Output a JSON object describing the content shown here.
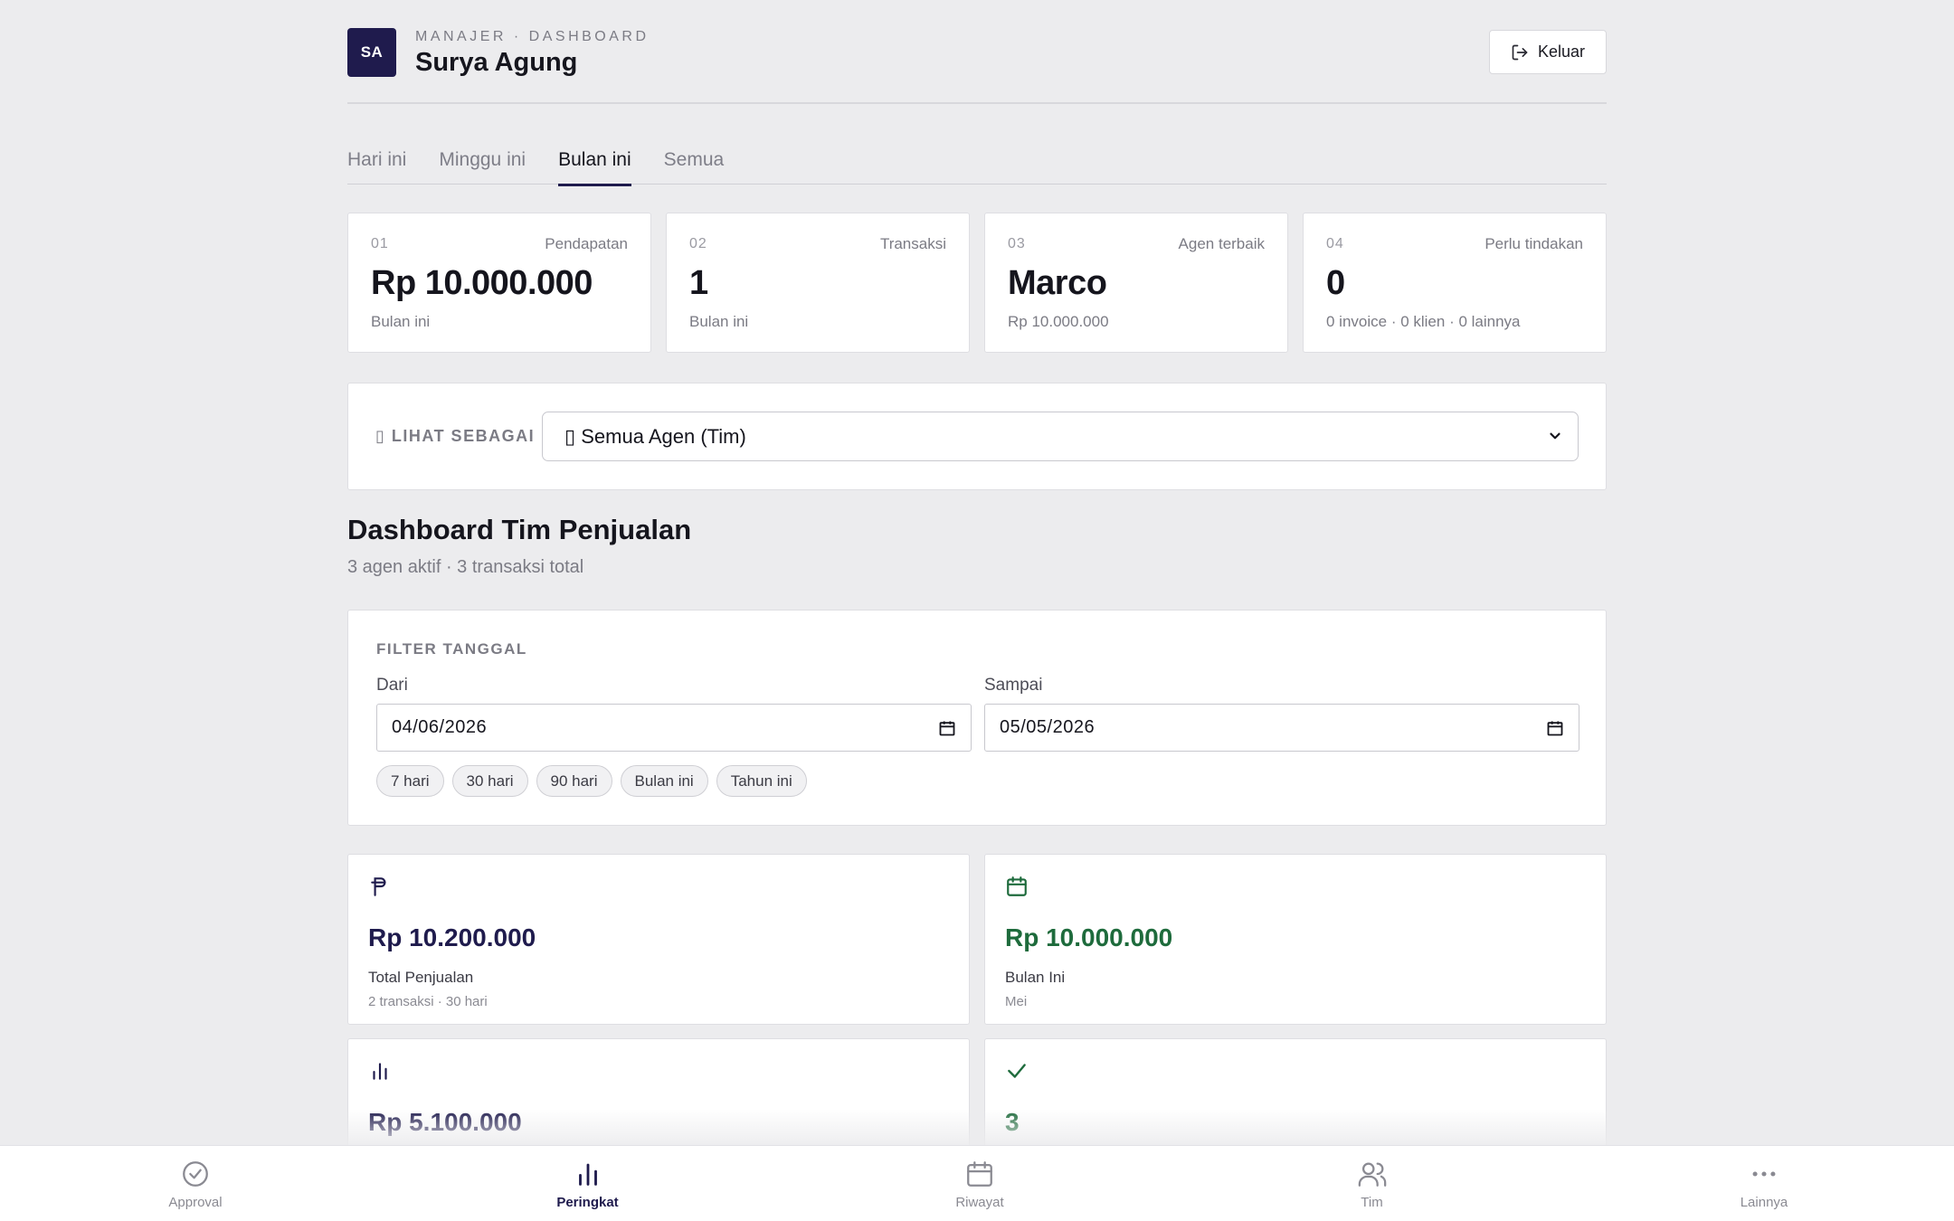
{
  "header": {
    "avatar_initials": "SA",
    "meta": "MANAJER · DASHBOARD",
    "name": "Surya Agung",
    "logout_label": "Keluar"
  },
  "tabs": [
    {
      "label": "Hari ini",
      "active": false
    },
    {
      "label": "Minggu ini",
      "active": false
    },
    {
      "label": "Bulan ini",
      "active": true
    },
    {
      "label": "Semua",
      "active": false
    }
  ],
  "stats": [
    {
      "num": "01",
      "label": "Pendapatan",
      "value": "Rp 10.000.000",
      "sub": "Bulan ini"
    },
    {
      "num": "02",
      "label": "Transaksi",
      "value": "1",
      "sub": "Bulan ini"
    },
    {
      "num": "03",
      "label": "Agen terbaik",
      "value": "Marco",
      "sub": "Rp 10.000.000"
    },
    {
      "num": "04",
      "label": "Perlu tindakan",
      "value": "0",
      "sub": "0 invoice · 0 klien · 0 lainnya"
    }
  ],
  "view_as": {
    "label": "▯ LIHAT SEBAGAI",
    "selected": "▯ Semua Agen (Tim)"
  },
  "section": {
    "title": "Dashboard Tim Penjualan",
    "subtitle": "3 agen aktif · 3 transaksi total"
  },
  "filter": {
    "title": "FILTER TANGGAL",
    "from_label": "Dari",
    "from_value": "04/06/2026",
    "to_label": "Sampai",
    "to_value": "05/05/2026",
    "chips": [
      "7 hari",
      "30 hari",
      "90 hari",
      "Bulan ini",
      "Tahun ini"
    ]
  },
  "metrics": [
    {
      "icon": "rupiah-icon",
      "value": "Rp 10.200.000",
      "label": "Total Penjualan",
      "sub": "2 transaksi · 30 hari",
      "color": "#1f1b4d"
    },
    {
      "icon": "calendar-icon",
      "value": "Rp 10.000.000",
      "label": "Bulan Ini",
      "sub": "Mei",
      "color": "#1e6b3c"
    },
    {
      "icon": "bar-chart-icon",
      "value": "Rp 5.100.000",
      "label": "",
      "sub": "",
      "color": "#1f1b4d"
    },
    {
      "icon": "check-icon",
      "value": "3",
      "label": "",
      "sub": "",
      "color": "#1e6b3c"
    }
  ],
  "bottom_nav": [
    {
      "label": "Approval",
      "icon": "check-circle-icon",
      "active": false
    },
    {
      "label": "Peringkat",
      "icon": "bar-chart-icon",
      "active": true
    },
    {
      "label": "Riwayat",
      "icon": "calendar-icon",
      "active": false
    },
    {
      "label": "Tim",
      "icon": "users-icon",
      "active": false
    },
    {
      "label": "Lainnya",
      "icon": "more-icon",
      "active": false
    }
  ],
  "colors": {
    "brand": "#1f1b4d",
    "positive": "#1e6b3c",
    "background": "#ececee"
  }
}
